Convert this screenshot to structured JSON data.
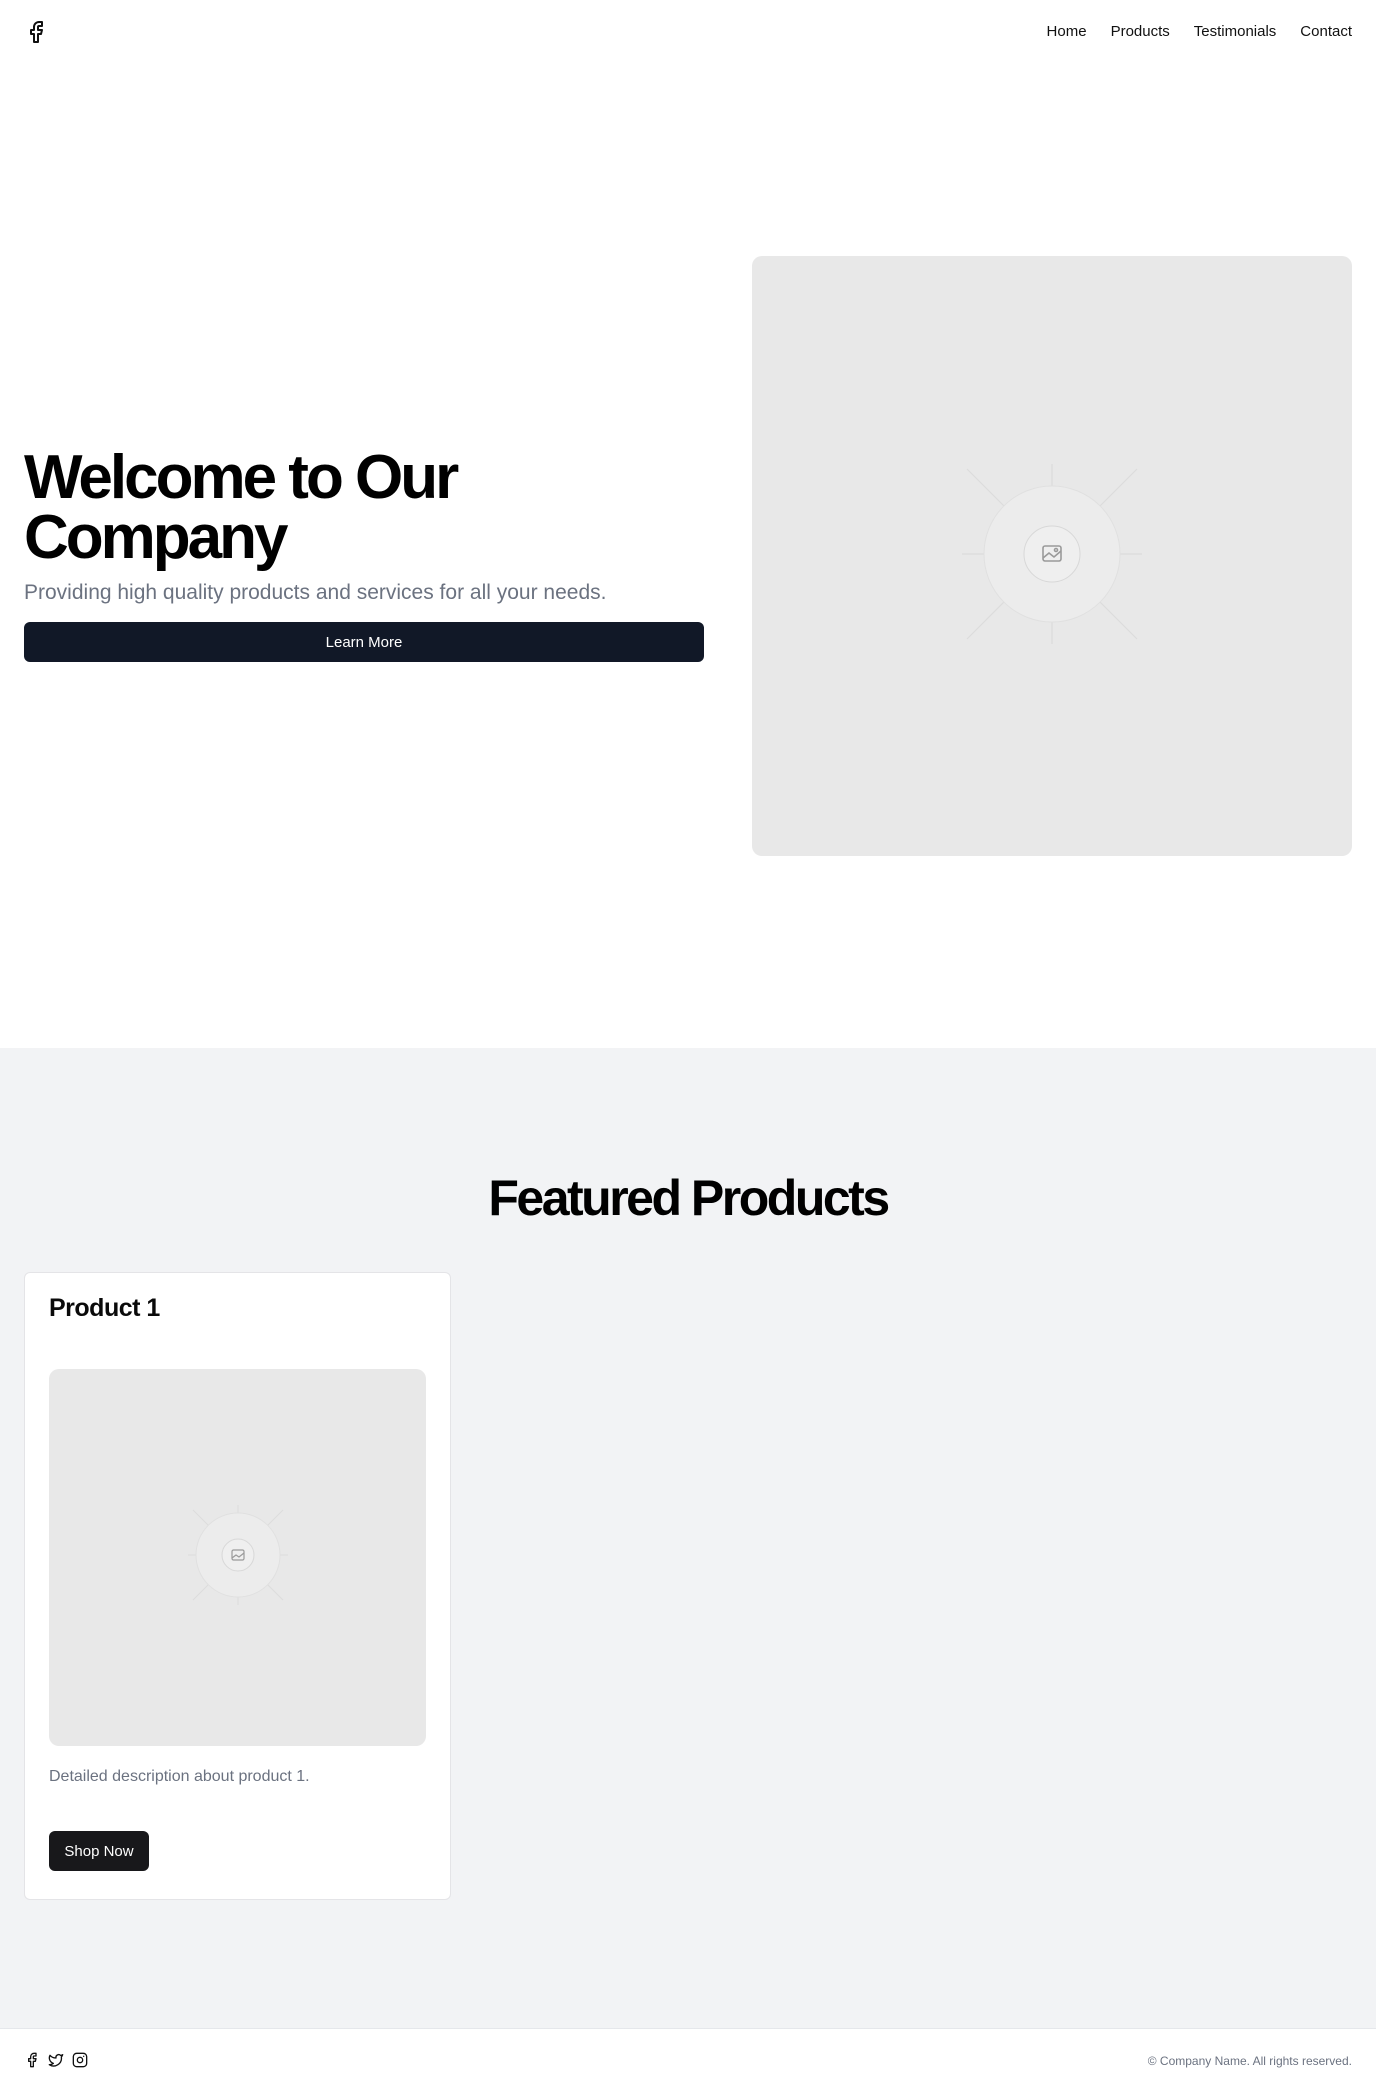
{
  "header": {
    "logo_icon": "facebook-icon",
    "nav": {
      "home": "Home",
      "products": "Products",
      "testimonials": "Testimonials",
      "contact": "Contact"
    }
  },
  "hero": {
    "title": "Welcome to Our Company",
    "subtitle": "Providing high quality products and services for all your needs.",
    "button_label": "Learn More",
    "image_icon": "image-placeholder-icon"
  },
  "featured": {
    "title": "Featured Products",
    "products": [
      {
        "name": "Product 1",
        "description": "Detailed description about product 1.",
        "button_label": "Shop Now",
        "image_icon": "image-placeholder-icon"
      }
    ]
  },
  "footer": {
    "social_icons": [
      "facebook-icon",
      "twitter-icon",
      "instagram-icon"
    ],
    "copyright": "© Company Name. All rights reserved."
  },
  "colors": {
    "primary_button": "#111827",
    "card_button": "#18181b",
    "section_bg": "#f2f3f5",
    "placeholder_bg": "#e8e8e8",
    "muted_text": "#6b7280"
  }
}
